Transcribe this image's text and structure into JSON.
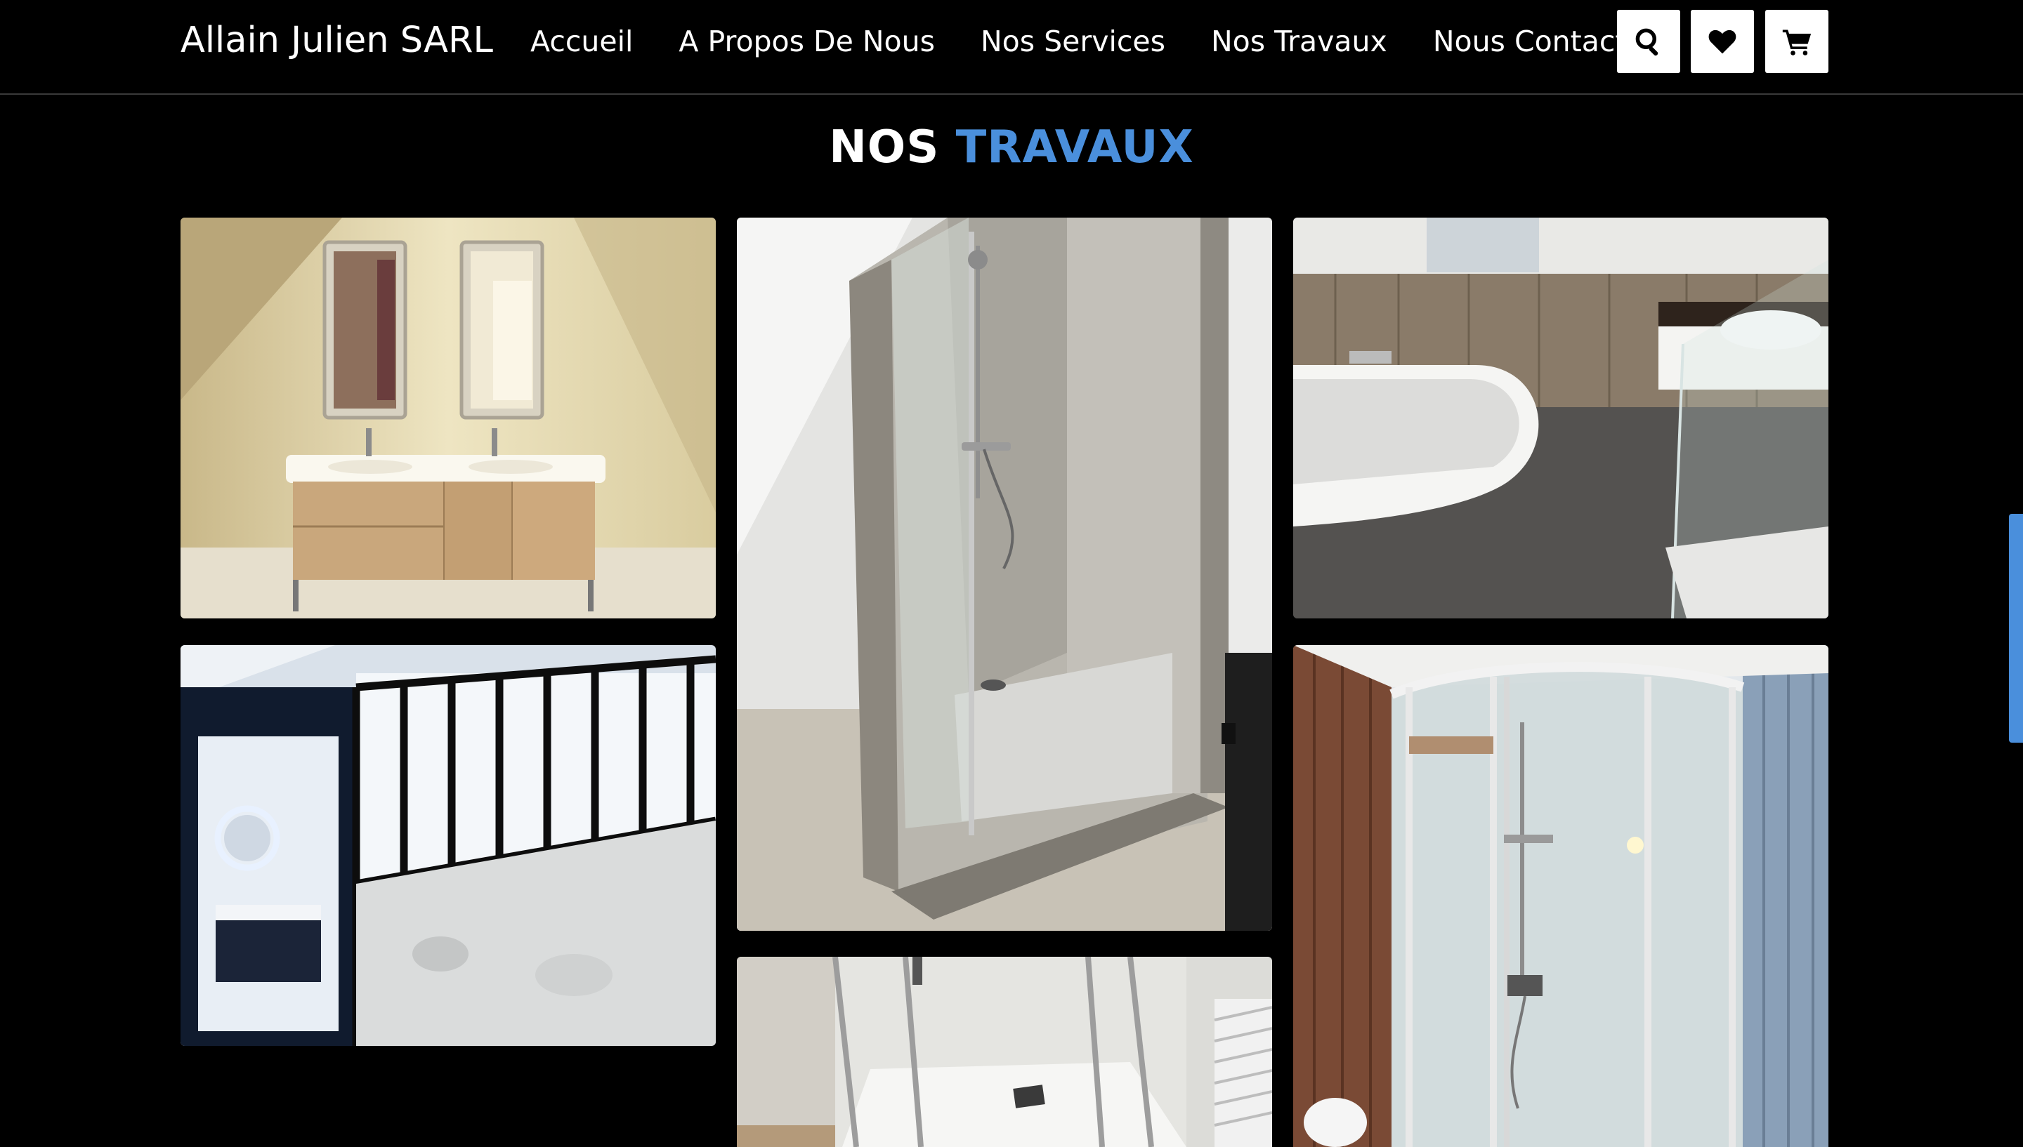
{
  "header": {
    "brand": "Allain Julien SARL",
    "nav": [
      "Accueil",
      "A Propos De Nous",
      "Nos Services",
      "Nos Travaux",
      "Nous Contacter"
    ],
    "icons": [
      "search-icon",
      "heart-icon",
      "cart-icon"
    ]
  },
  "section": {
    "title_part1": "NOS",
    "title_part2": "TRAVAUX",
    "accent_color": "#4a8fdc"
  },
  "gallery": {
    "photos": [
      "double-vanity-bathroom",
      "tiled-corner-shower",
      "bathtub-wood-wall",
      "glass-partition-bathroom",
      "quarter-round-shower-cabin",
      "glass-shower-white-tray"
    ]
  }
}
